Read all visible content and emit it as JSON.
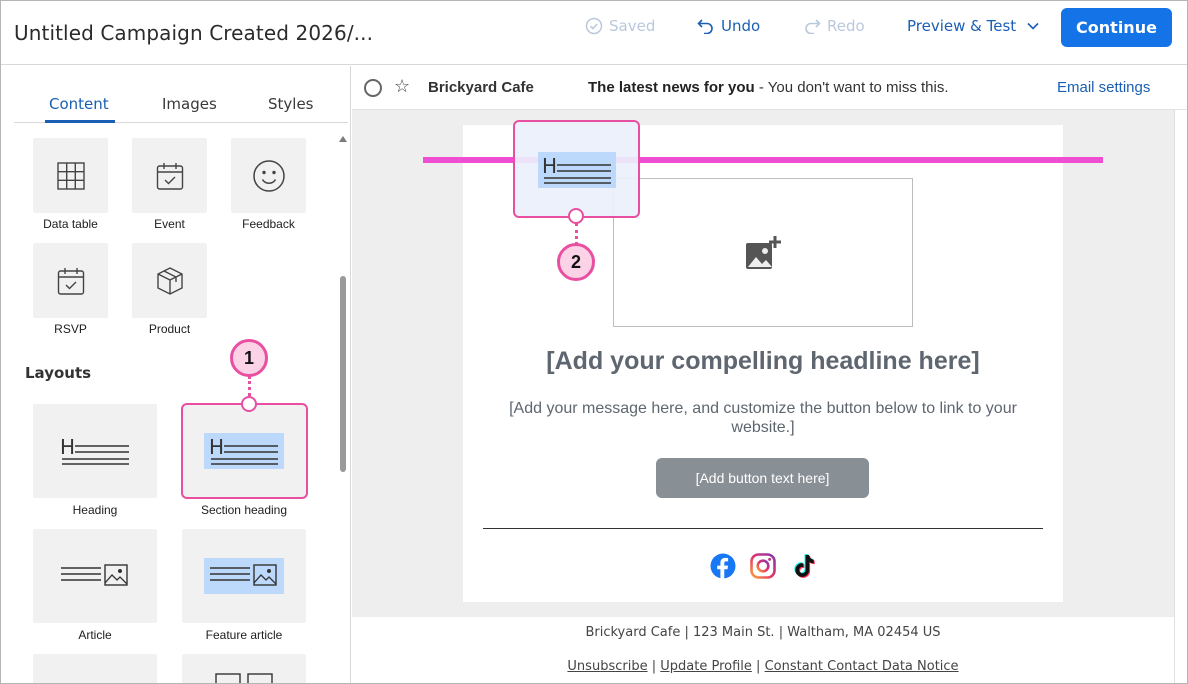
{
  "header": {
    "title": "Untitled Campaign Created 2026/...",
    "saved": "Saved",
    "undo": "Undo",
    "redo": "Redo",
    "preview": "Preview & Test",
    "continue": "Continue"
  },
  "tabs": [
    "Content",
    "Images",
    "Styles"
  ],
  "content_tiles": [
    {
      "label": "Data table",
      "icon": "table-icon"
    },
    {
      "label": "Event",
      "icon": "calendar-icon"
    },
    {
      "label": "Feedback",
      "icon": "smiley-icon"
    },
    {
      "label": "RSVP",
      "icon": "calendar-check-icon"
    },
    {
      "label": "Product",
      "icon": "box-icon"
    }
  ],
  "layouts_label": "Layouts",
  "layout_tiles": [
    {
      "label": "Heading",
      "icon": "heading-layout-icon"
    },
    {
      "label": "Section heading",
      "icon": "section-heading-layout-icon"
    },
    {
      "label": "Article",
      "icon": "article-layout-icon"
    },
    {
      "label": "Feature article",
      "icon": "feature-article-layout-icon"
    }
  ],
  "callouts": [
    "1",
    "2"
  ],
  "mail_header": {
    "from": "Brickyard Cafe",
    "subject": "The latest news for you",
    "preheader": " - You don't want to miss this.",
    "settings": "Email settings"
  },
  "email": {
    "headline": "[Add your compelling headline here]",
    "message": "[Add your message here, and customize the button below to link to your website.]",
    "button": "[Add button text here]",
    "social": [
      "facebook-icon",
      "instagram-icon",
      "tiktok-icon"
    ]
  },
  "footer": {
    "address": "Brickyard Cafe | 123 Main St. | Waltham, MA 02454 US",
    "links": [
      "Unsubscribe",
      "Update Profile",
      "Constant Contact Data Notice"
    ],
    "separator": "|"
  },
  "colors": {
    "accent": "#1473e6",
    "link": "#1a5fb4",
    "highlight": "#e94fa0",
    "drop_indicator": "#ee4fd2"
  }
}
